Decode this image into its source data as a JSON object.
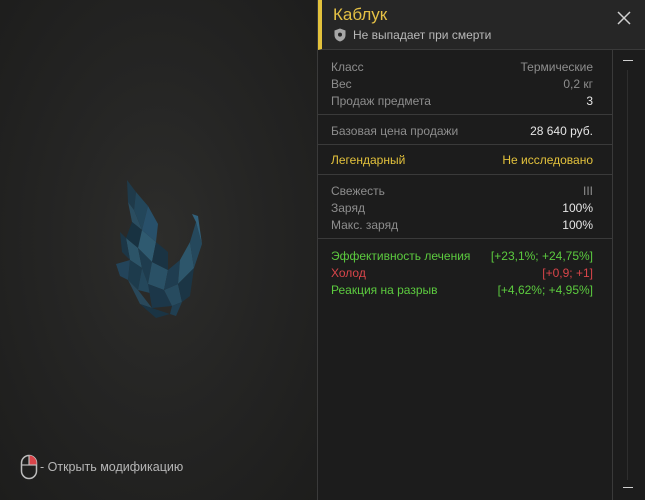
{
  "item": {
    "title": "Каблук",
    "subtitle": "Не выпадает при смерти"
  },
  "hint": {
    "text": "- Открыть модификацию"
  },
  "stats": [
    {
      "label": "Класс",
      "value": "Термические"
    },
    {
      "label": "Вес",
      "value": "0,2 кг"
    },
    {
      "label": "Продаж предмета",
      "value": "3"
    }
  ],
  "price": {
    "label": "Базовая цена продажи",
    "value": "28 640 руб."
  },
  "rarity": {
    "label": "Легендарный",
    "value": "Не исследовано"
  },
  "freshness": [
    {
      "label": "Свежесть",
      "value": "III"
    },
    {
      "label": "Заряд",
      "value": "100%"
    },
    {
      "label": "Макс. заряд",
      "value": "100%"
    }
  ],
  "effects": [
    {
      "label": "Эффективность лечения",
      "value": "[+23,1%; +24,75%]",
      "tone": "positive"
    },
    {
      "label": "Холод",
      "value": "[+0,9; +1]",
      "tone": "negative"
    },
    {
      "label": "Реакция на разрыв",
      "value": "[+4,62%; +4,95%]",
      "tone": "positive"
    }
  ],
  "icons": {
    "close": "close-icon",
    "shield": "shield-icon",
    "mouse": "mouse-icon"
  },
  "colors": {
    "accent": "#e3c23c",
    "positive": "#5ccb3f",
    "negative": "#d9454a"
  }
}
